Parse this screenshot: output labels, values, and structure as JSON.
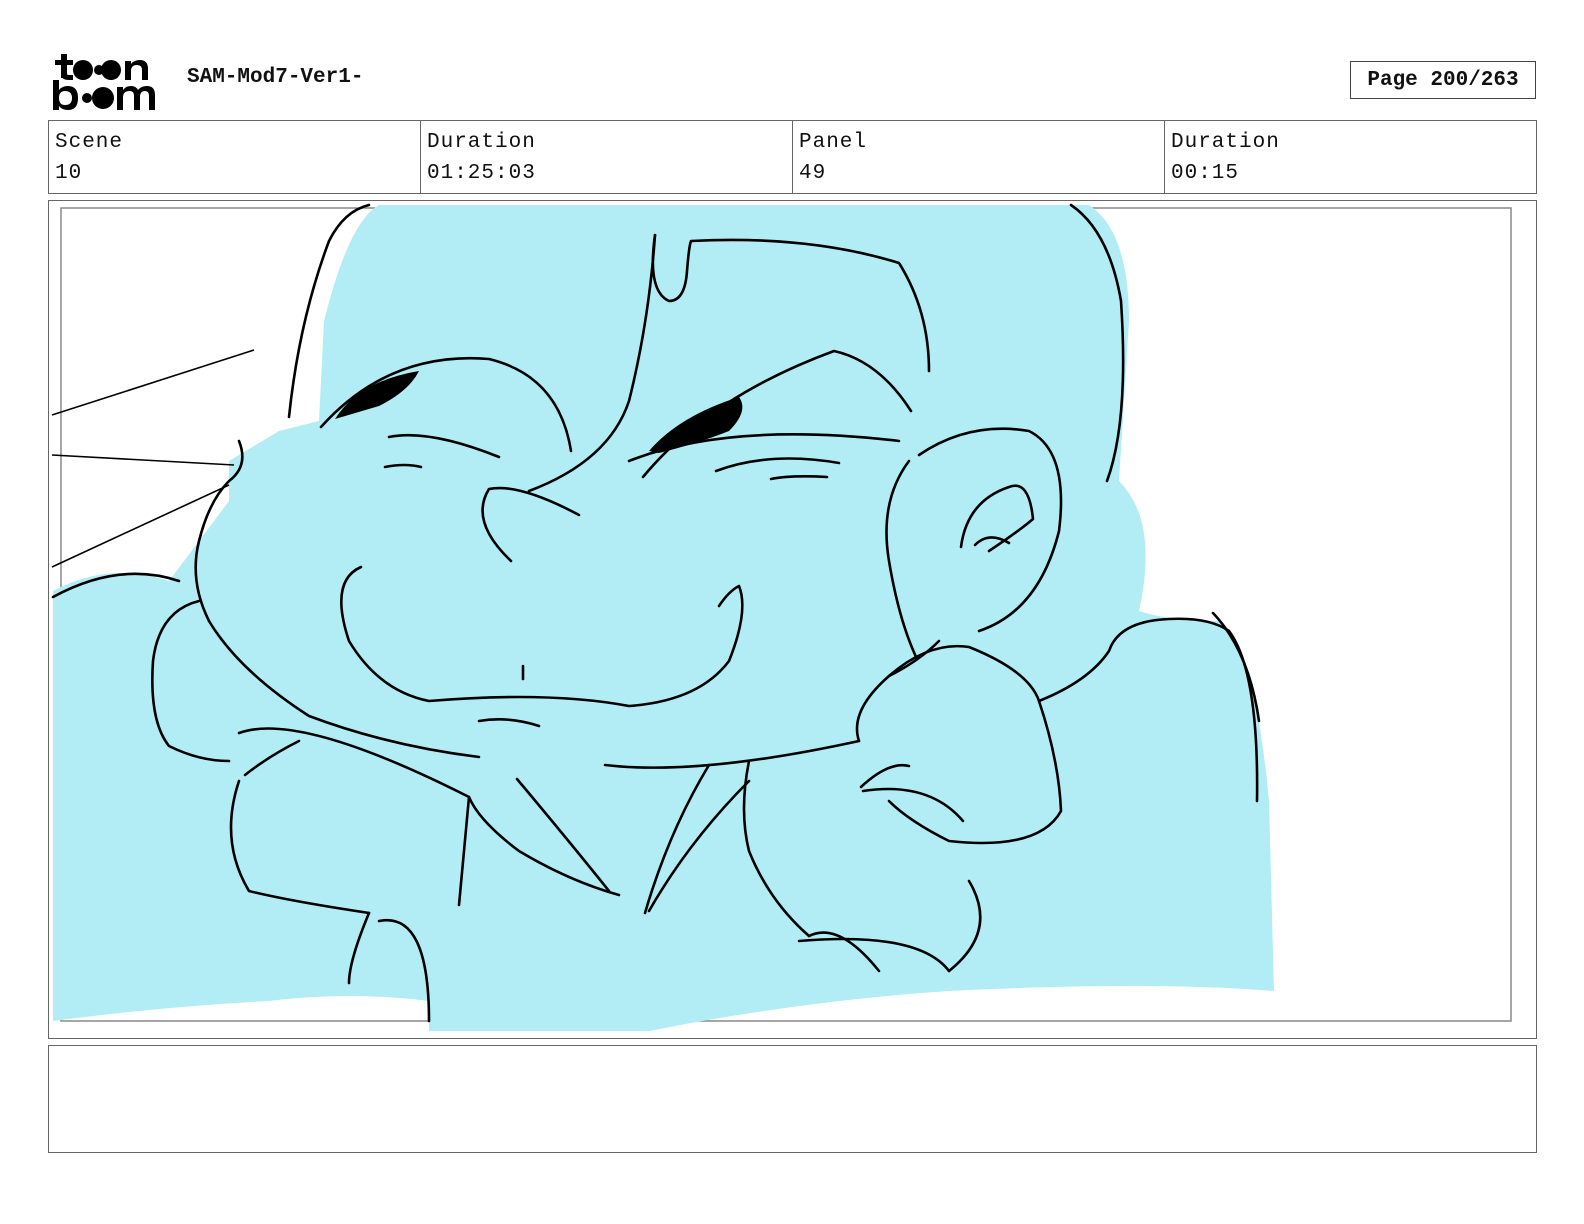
{
  "header": {
    "logo_text": "toon boom",
    "project_title": "SAM-Mod7-Ver1-",
    "page_label": "Page 200/263"
  },
  "info": {
    "scene_label": "Scene",
    "scene_value": "10",
    "scene_duration_label": "Duration",
    "scene_duration_value": "01:25:03",
    "panel_label": "Panel",
    "panel_value": "49",
    "panel_duration_label": "Duration",
    "panel_duration_value": "00:15"
  },
  "panel": {
    "fill_color": "#b2edf6",
    "line_color": "#000000"
  },
  "notes": {
    "text": ""
  }
}
